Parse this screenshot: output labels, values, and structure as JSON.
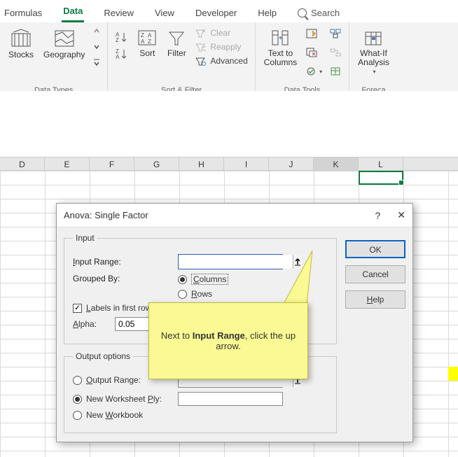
{
  "ribbon": {
    "tabs": [
      "Formulas",
      "Data",
      "Review",
      "View",
      "Developer",
      "Help"
    ],
    "active": "Data",
    "search": "Search",
    "groups": {
      "datatypes": {
        "label": "Data Types",
        "stocks": "Stocks",
        "geography": "Geography"
      },
      "sortfilter": {
        "label": "Sort & Filter",
        "sort": "Sort",
        "filter": "Filter",
        "clear": "Clear",
        "reapply": "Reapply",
        "advanced": "Advanced"
      },
      "datatools": {
        "label": "Data Tools",
        "texttocols": "Text to\nColumns"
      },
      "forecast": {
        "label": "Foreca",
        "whatif": "What-If\nAnalysis"
      }
    }
  },
  "columns": [
    "D",
    "E",
    "F",
    "G",
    "H",
    "I",
    "J",
    "K",
    "L"
  ],
  "activeColumn": "K",
  "dialog": {
    "title": "Anova: Single Factor",
    "input_legend": "Input",
    "input_range_label": "Input Range:",
    "input_range_value": "",
    "grouped_by_label": "Grouped By:",
    "grouped_columns": "Columns",
    "grouped_rows": "Rows",
    "labels_first_row": "Labels in first row",
    "alpha_label": "Alpha:",
    "alpha_value": "0.05",
    "output_legend": "Output options",
    "output_range": "Output Range:",
    "new_ws_ply": "New Worksheet Ply:",
    "new_workbook": "New Workbook",
    "ok": "OK",
    "cancel": "Cancel",
    "help": "Help"
  },
  "callout": {
    "pre": "Next to ",
    "bold": "Input Range",
    "post": ", click the up arrow."
  }
}
